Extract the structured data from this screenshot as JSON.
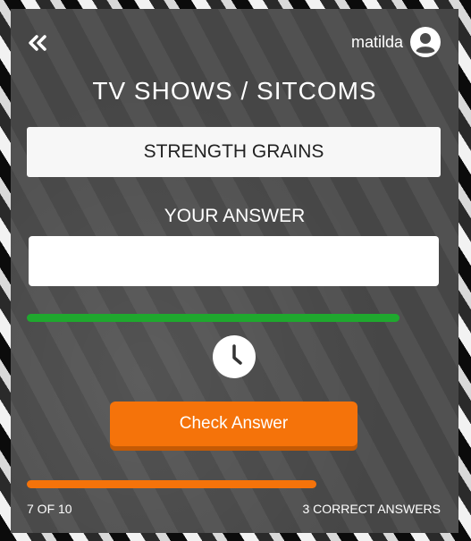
{
  "user": {
    "name": "matilda"
  },
  "quiz": {
    "category": "TV SHOWS / SITCOMS",
    "question": "STRENGTH GRAINS",
    "answer_label": "YOUR ANSWER",
    "answer_value": "",
    "answer_placeholder": "",
    "timer_remaining_fraction": 0.9,
    "check_button_label": "Check Answer",
    "question_index": 7,
    "question_total": 10,
    "progress_text": "7 OF 10",
    "correct_text": "3 CORRECT ANSWERS"
  },
  "colors": {
    "card": "#4a4a4a",
    "timer_bar": "#1fa82e",
    "accent": "#f5730a"
  },
  "icons": [
    "double-chevron-left-icon",
    "user-avatar-icon",
    "clock-icon"
  ]
}
